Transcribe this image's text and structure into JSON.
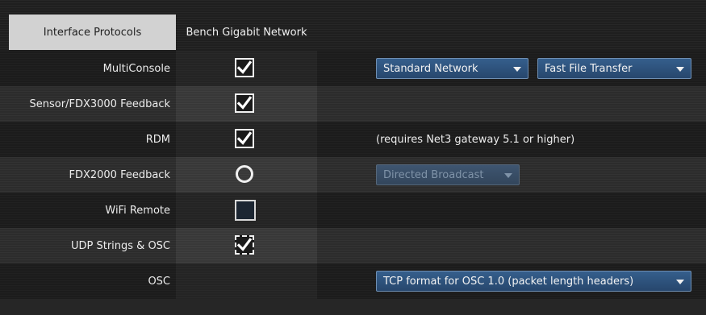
{
  "tabs": [
    {
      "label": "Interface Protocols",
      "active": true
    },
    {
      "label": "Bench Gigabit Network",
      "active": false
    }
  ],
  "rows": [
    {
      "label": "MultiConsole",
      "control": "checkbox",
      "checked": true,
      "dropdowns": [
        {
          "value": "Standard Network"
        },
        {
          "value": "Fast File Transfer"
        }
      ]
    },
    {
      "label": "Sensor/FDX3000 Feedback",
      "control": "checkbox",
      "checked": true
    },
    {
      "label": "RDM",
      "control": "checkbox",
      "checked": true,
      "note": "(requires Net3 gateway 5.1 or higher)"
    },
    {
      "label": "FDX2000 Feedback",
      "control": "radio",
      "checked": false,
      "dropdowns": [
        {
          "value": "Directed Broadcast",
          "disabled": true
        }
      ]
    },
    {
      "label": "WiFi Remote",
      "control": "checkbox",
      "checked": false
    },
    {
      "label": "UDP Strings & OSC",
      "control": "checkbox",
      "checked": true,
      "focused": true
    },
    {
      "label": "OSC",
      "control": "none",
      "dropdowns": [
        {
          "value": "TCP format for OSC 1.0 (packet length headers)"
        }
      ]
    }
  ],
  "icons": {
    "check": "checkmark-icon",
    "dropdown": "chevron-down-icon"
  },
  "colors": {
    "tab_active_bg": "#d2d2d2",
    "dropdown_bg": "#2f5580",
    "dropdown_disabled_text": "#7f93a8"
  }
}
